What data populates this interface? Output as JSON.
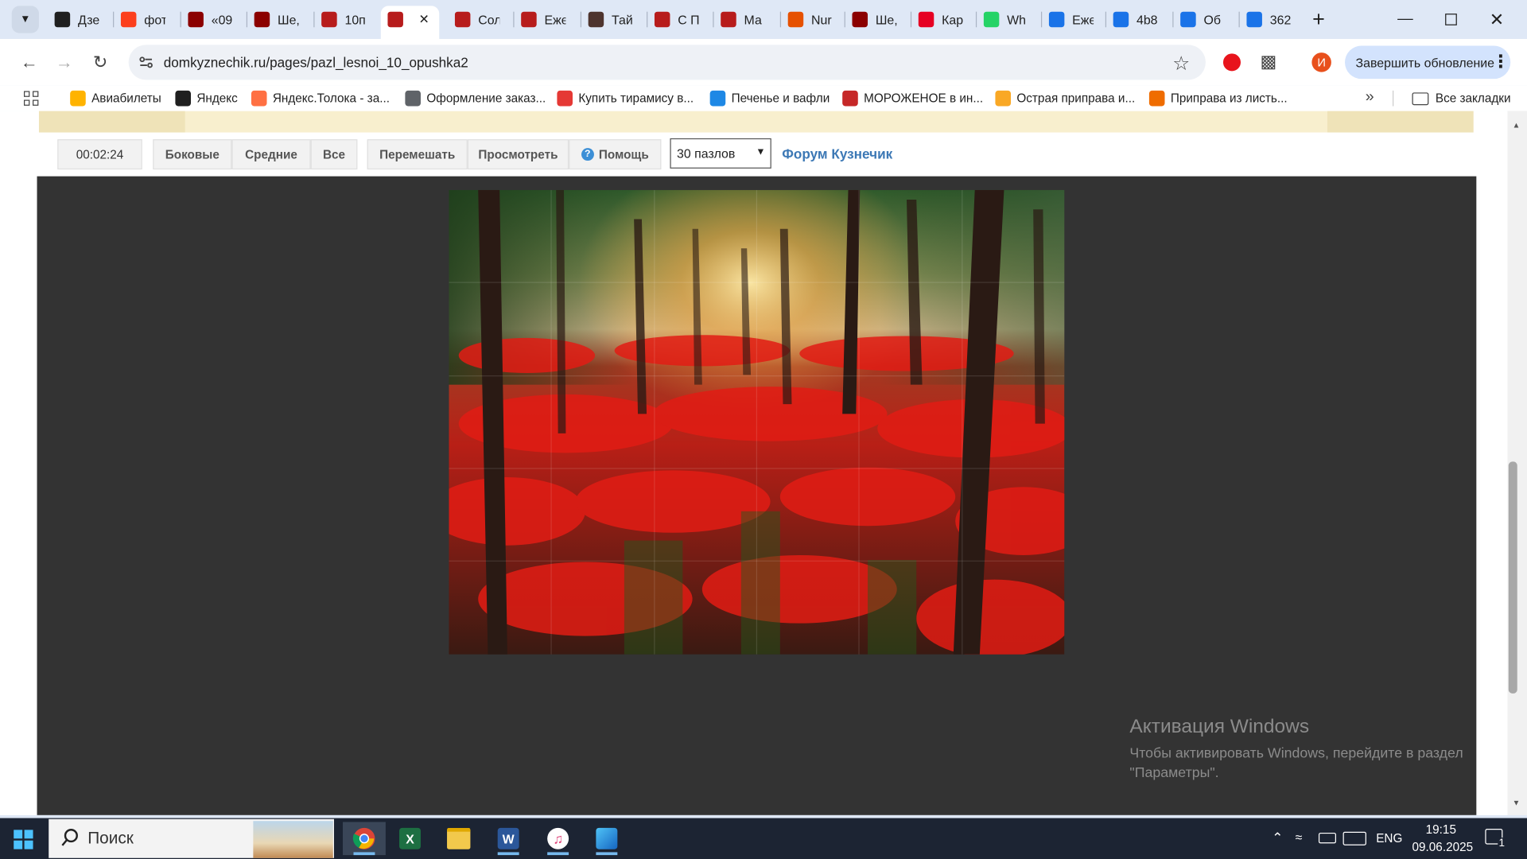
{
  "browser": {
    "tabs": [
      {
        "title": "Дзе",
        "icon": "plus-icon",
        "color": "#1f1f1f"
      },
      {
        "title": "фот",
        "icon": "yandex-icon",
        "color": "#fc3f1d"
      },
      {
        "title": "«09",
        "icon": "grasshopper-icon",
        "color": "#8b0000"
      },
      {
        "title": "Ше,",
        "icon": "grasshopper-icon",
        "color": "#8b0000"
      },
      {
        "title": "10п",
        "icon": "site-icon",
        "color": "#b71c1c"
      },
      {
        "title": "",
        "icon": "site-icon",
        "color": "#b71c1c",
        "active": true
      },
      {
        "title": "Сол",
        "icon": "site-icon",
        "color": "#b71c1c"
      },
      {
        "title": "Еже",
        "icon": "site-icon",
        "color": "#b71c1c"
      },
      {
        "title": "Тай",
        "icon": "image-icon",
        "color": "#4e342e"
      },
      {
        "title": "С П",
        "icon": "site-icon",
        "color": "#b71c1c"
      },
      {
        "title": "Ма",
        "icon": "site-icon",
        "color": "#b71c1c"
      },
      {
        "title": "Nur",
        "icon": "nur-icon",
        "color": "#e65100"
      },
      {
        "title": "Ше,",
        "icon": "grasshopper-icon",
        "color": "#8b0000"
      },
      {
        "title": "Кар",
        "icon": "pinterest-icon",
        "color": "#e60023"
      },
      {
        "title": "Wh",
        "icon": "whatsapp-icon",
        "color": "#25d366"
      },
      {
        "title": "Еже",
        "icon": "doc-icon",
        "color": "#1a73e8"
      },
      {
        "title": "4b8",
        "icon": "doc-icon",
        "color": "#1a73e8"
      },
      {
        "title": "Об",
        "icon": "doc-icon",
        "color": "#1a73e8"
      },
      {
        "title": "362",
        "icon": "doc-icon",
        "color": "#1a73e8"
      }
    ],
    "url": "domkyznechik.ru/pages/pazl_lesnoi_10_opushka2",
    "update_label": "Завершить обновление",
    "profile_initial": "И",
    "bookmarks": [
      {
        "label": "Авиабилеты",
        "icon": "travel-icon",
        "color": "#ffb300"
      },
      {
        "label": "Яндекс",
        "icon": "plus-icon",
        "color": "#1f1f1f"
      },
      {
        "label": "Яндекс.Толока - за...",
        "icon": "toloka-icon",
        "color": "#ff7043"
      },
      {
        "label": "Оформление заказ...",
        "icon": "globe-icon",
        "color": "#5f6368"
      },
      {
        "label": "Купить тирамису в...",
        "icon": "cake-icon",
        "color": "#e53935"
      },
      {
        "label": "Печенье и вафли",
        "icon": "basket-icon",
        "color": "#1e88e5"
      },
      {
        "label": "МОРОЖЕНОЕ в ин...",
        "icon": "shop-icon",
        "color": "#c62828"
      },
      {
        "label": "Острая приправа и...",
        "icon": "spice-icon",
        "color": "#f9a825"
      },
      {
        "label": "Приправа из листь...",
        "icon": "herb-icon",
        "color": "#ef6c00"
      }
    ],
    "all_bookmarks_label": "Все закладки"
  },
  "puzzle_page": {
    "timer": "00:02:24",
    "filter_buttons": [
      "Боковые",
      "Средние",
      "Все"
    ],
    "action_buttons": [
      "Перемешать",
      "Просмотреть"
    ],
    "help_label": "Помощь",
    "pieces_select": "30 пазлов",
    "forum_link": "Форум Кузнечик"
  },
  "watermark": {
    "title": "Активация Windows",
    "text": "Чтобы активировать Windows, перейдите в раздел \"Параметры\"."
  },
  "taskbar": {
    "search_placeholder": "Поиск",
    "apps": [
      "chrome-icon",
      "excel-icon",
      "explorer-icon",
      "word-icon",
      "itunes-icon",
      "photos-icon"
    ],
    "language": "ENG",
    "time": "19:15",
    "date": "09.06.2025",
    "notifications": "1"
  }
}
